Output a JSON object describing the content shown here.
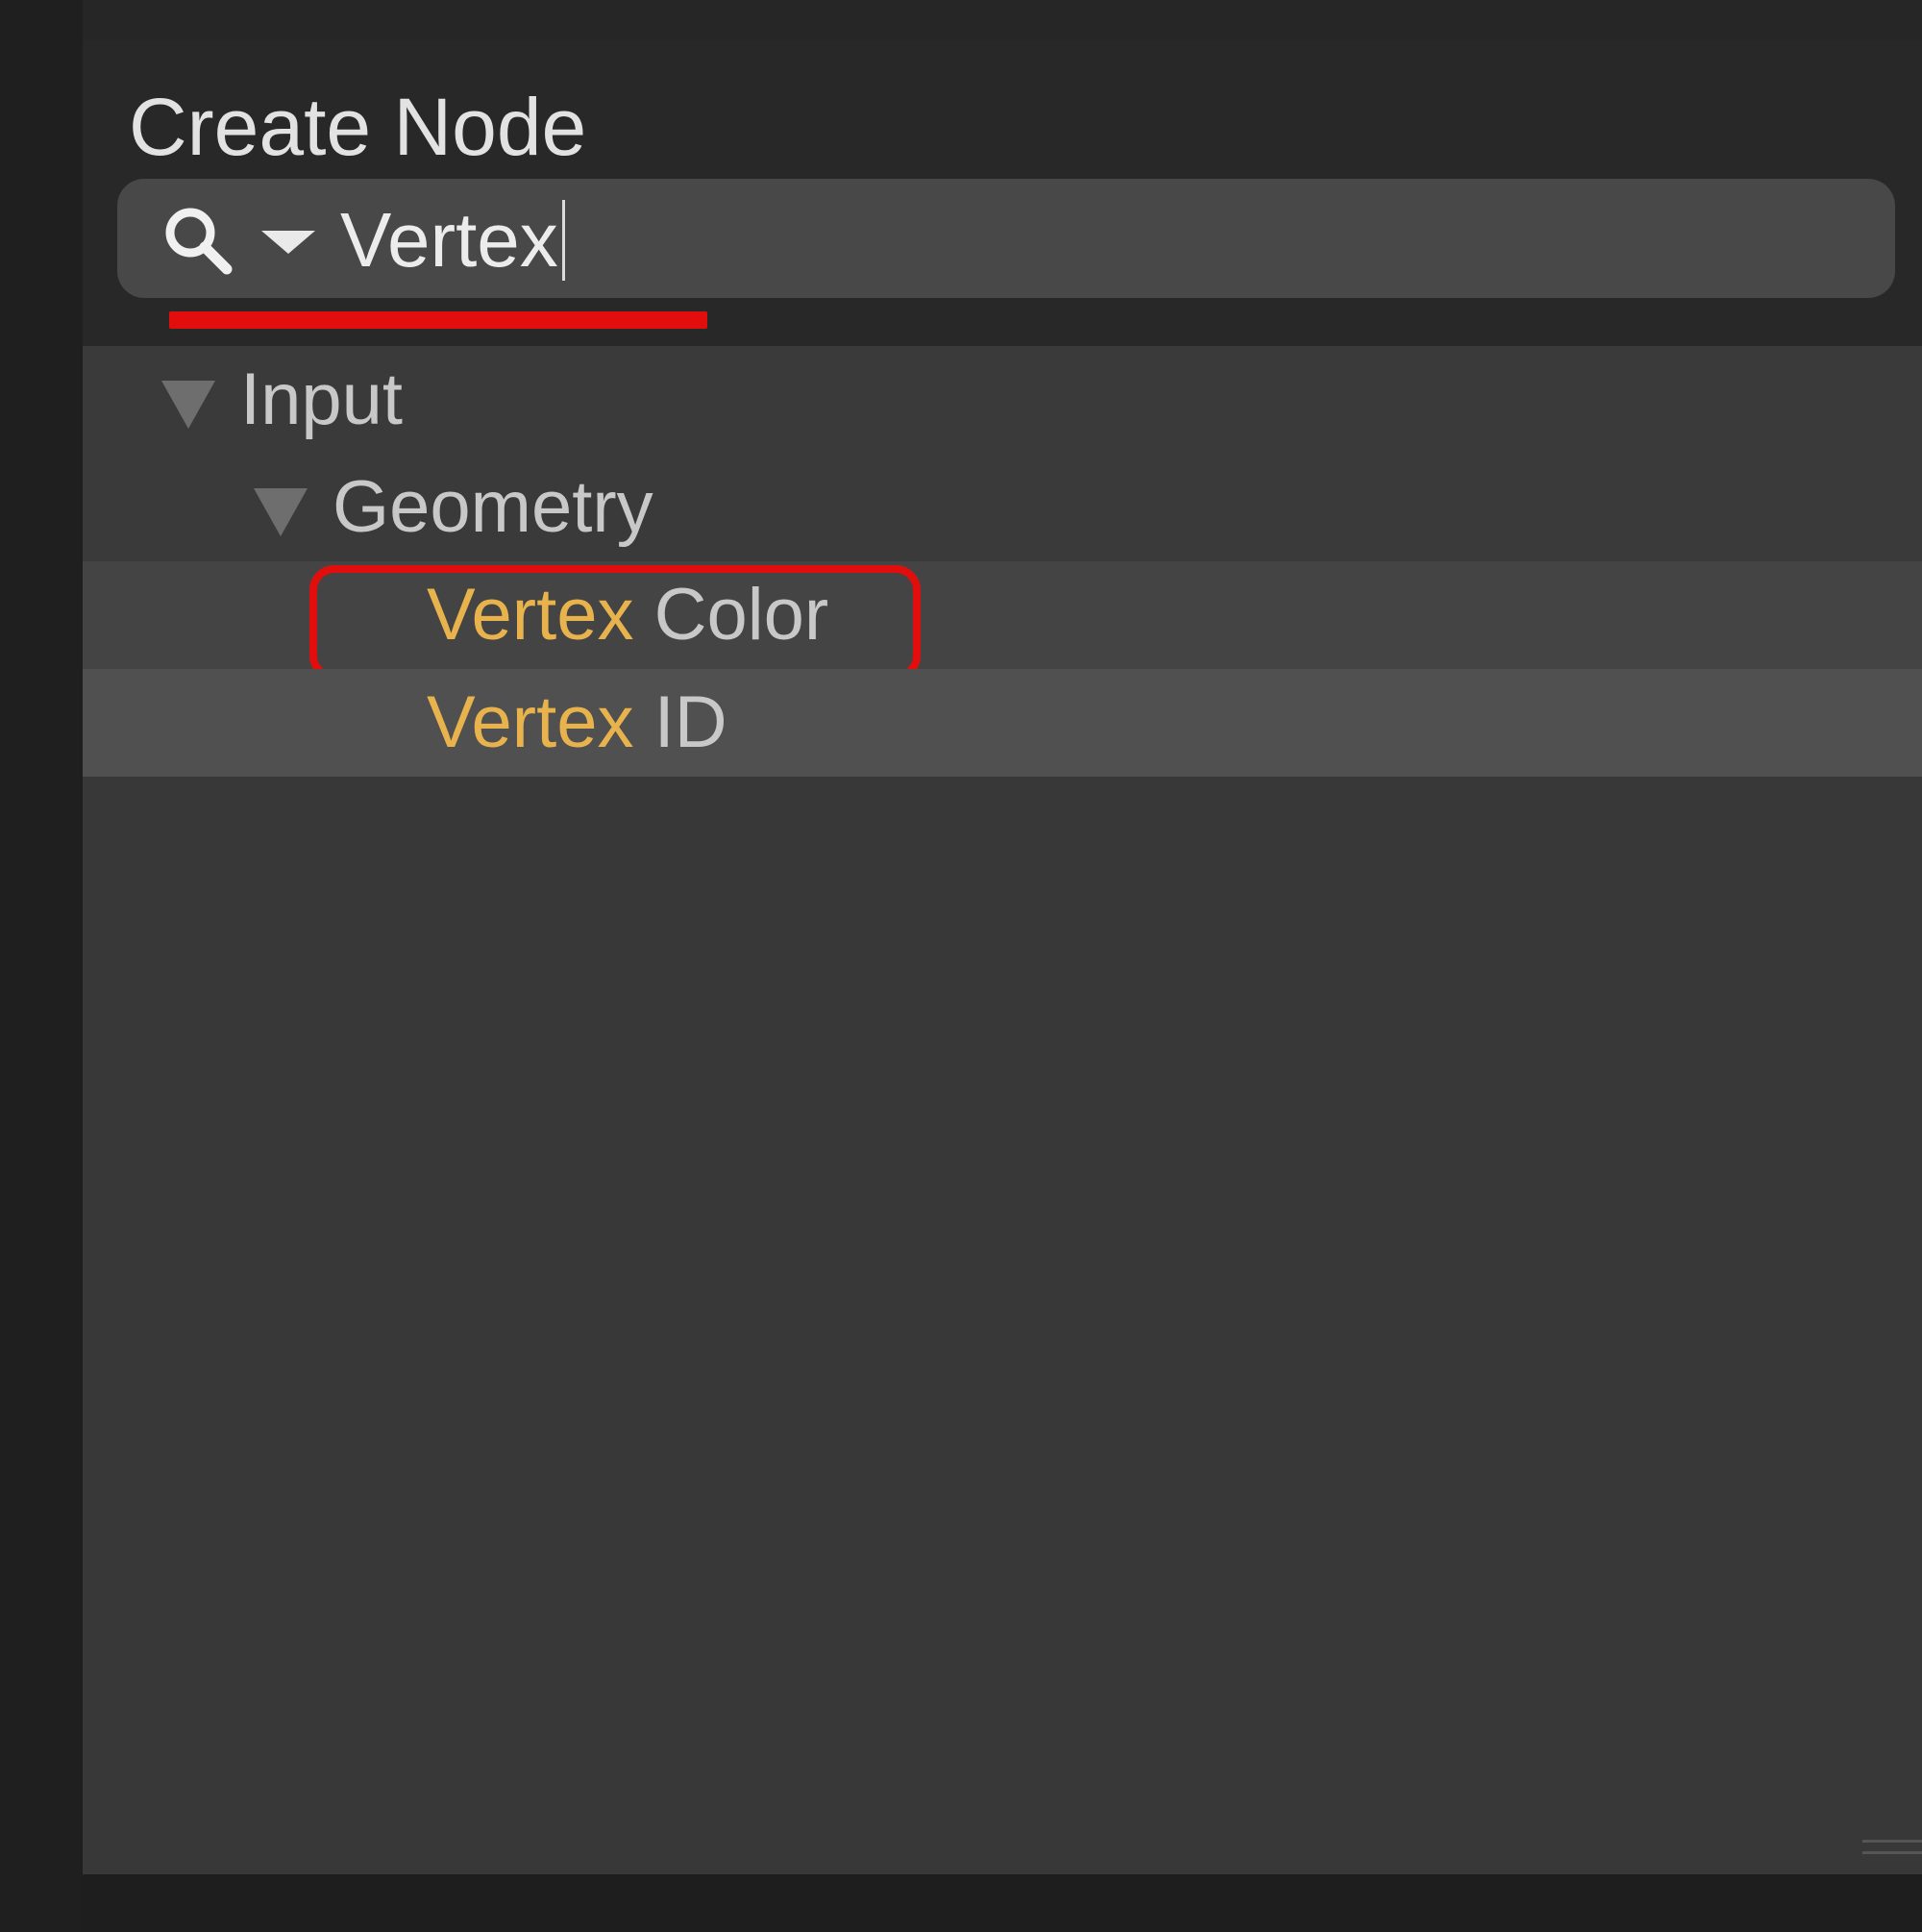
{
  "panel": {
    "title": "Create Node"
  },
  "search": {
    "value": "Vertex",
    "icon": "search-icon",
    "dropdown_icon": "chevron-down-icon"
  },
  "tree": {
    "category": {
      "label": "Input",
      "expanded": true
    },
    "subcategory": {
      "label": "Geometry",
      "expanded": true
    },
    "items": [
      {
        "match": "Vertex",
        "rest": " Color",
        "label": "Vertex Color",
        "annotated": true
      },
      {
        "match": "Vertex",
        "rest": " ID",
        "label": "Vertex ID",
        "selected": true
      }
    ]
  },
  "colors": {
    "panel_bg": "#383838",
    "header_bg": "#282828",
    "search_bg": "#484848",
    "match_highlight": "#e8b34d",
    "annotation_red": "#e20d0d",
    "selected_row": "#505050"
  }
}
